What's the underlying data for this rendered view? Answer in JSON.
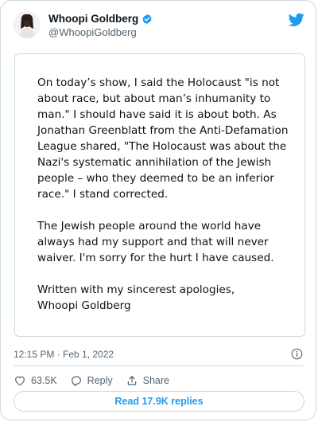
{
  "tweet": {
    "display_name": "Whoopi Goldberg",
    "handle": "@WhoopiGoldberg",
    "timestamp": "12:15 PM · Feb 1, 2022",
    "note_paragraphs": [
      "On today’s show, I said the Holocaust \"is not about race, but about man’s inhumanity to man.\" I should have said it is about both. As Jonathan Greenblatt from the Anti-Defamation League shared, \"The Holocaust was about the Nazi's systematic annihilation of the Jewish people – who they deemed to be an inferior race.\" I stand corrected.",
      "The Jewish people around the world have always had my support and that will never waiver. I'm sorry for the hurt I have caused.",
      "Written with my sincerest apologies,\nWhoopi Goldberg"
    ]
  },
  "actions": {
    "likes": "63.5K",
    "reply_label": "Reply",
    "share_label": "Share"
  },
  "replies_button": "Read 17.9K replies",
  "colors": {
    "accent": "#1d9bf0",
    "border": "#cfd9de",
    "muted_text": "#536471"
  },
  "icons": {
    "verified": "verified-badge-icon",
    "brand": "twitter-bird-icon",
    "info": "info-icon",
    "like": "heart-icon",
    "reply": "reply-bubble-icon",
    "share": "share-upload-icon"
  }
}
